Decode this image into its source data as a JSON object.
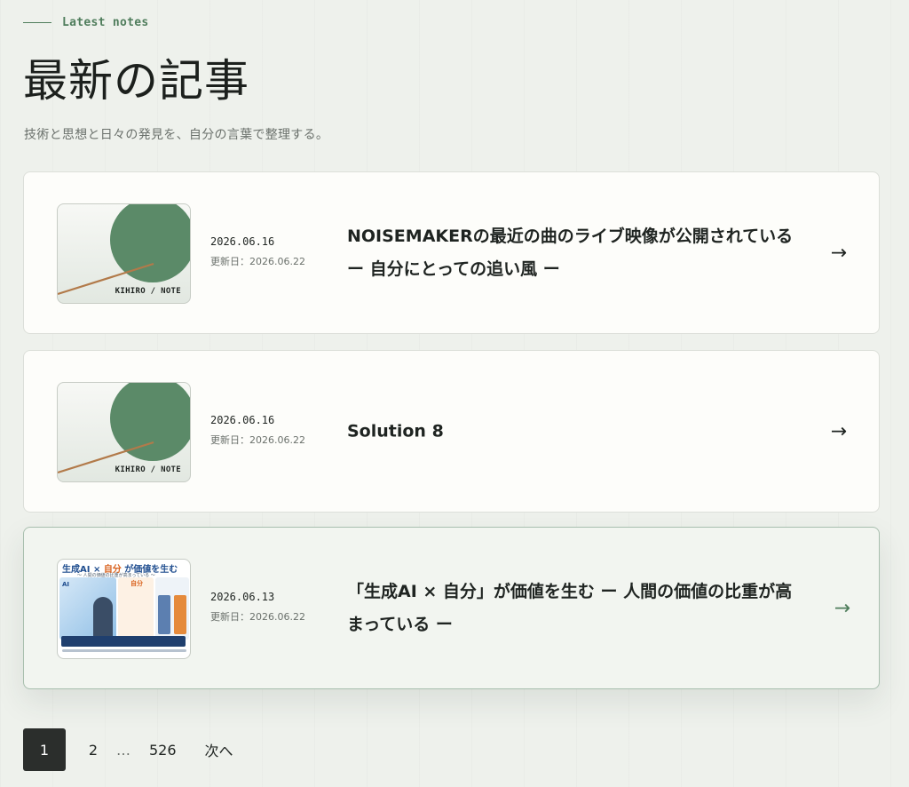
{
  "header": {
    "eyebrow": "Latest notes",
    "title": "最新の記事",
    "subtitle": "技術と思想と日々の発見を、自分の言葉で整理する。"
  },
  "posts": [
    {
      "date": "2026.06.16",
      "updated": "更新日：2026.06.22",
      "title": "NOISEMAKERの最近の曲のライブ映像が公開されている ー 自分にとっての追い風 ー",
      "thumb_label": "KIHIRO / NOTE",
      "arrow": "→"
    },
    {
      "date": "2026.06.16",
      "updated": "更新日：2026.06.22",
      "title": "Solution 8",
      "thumb_label": "KIHIRO / NOTE",
      "arrow": "→"
    },
    {
      "date": "2026.06.13",
      "updated": "更新日：2026.06.22",
      "title": "「生成AI × 自分」が価値を生む ー 人間の価値の比重が高まっている ー",
      "thumb_title_prefix": "生成AI × ",
      "thumb_title_accent": "自分",
      "thumb_title_suffix": " が価値を生む",
      "thumb_subtitle": "〜 人間の価値の比重が高まっている 〜",
      "thumb_ai": "AI",
      "thumb_self": "自分",
      "arrow": "→"
    }
  ],
  "pagination": {
    "current": "1",
    "page2": "2",
    "dots": "…",
    "last": "526",
    "next": "次へ"
  },
  "colors": {
    "background": "#eef1ec",
    "accent_green": "#4f7d5c",
    "thumb_circle": "#5b8a68",
    "thumb_line": "#b27a4a",
    "pagination_active": "#2b2e2c"
  },
  "icons": {
    "arrow": "arrow-right-icon"
  }
}
